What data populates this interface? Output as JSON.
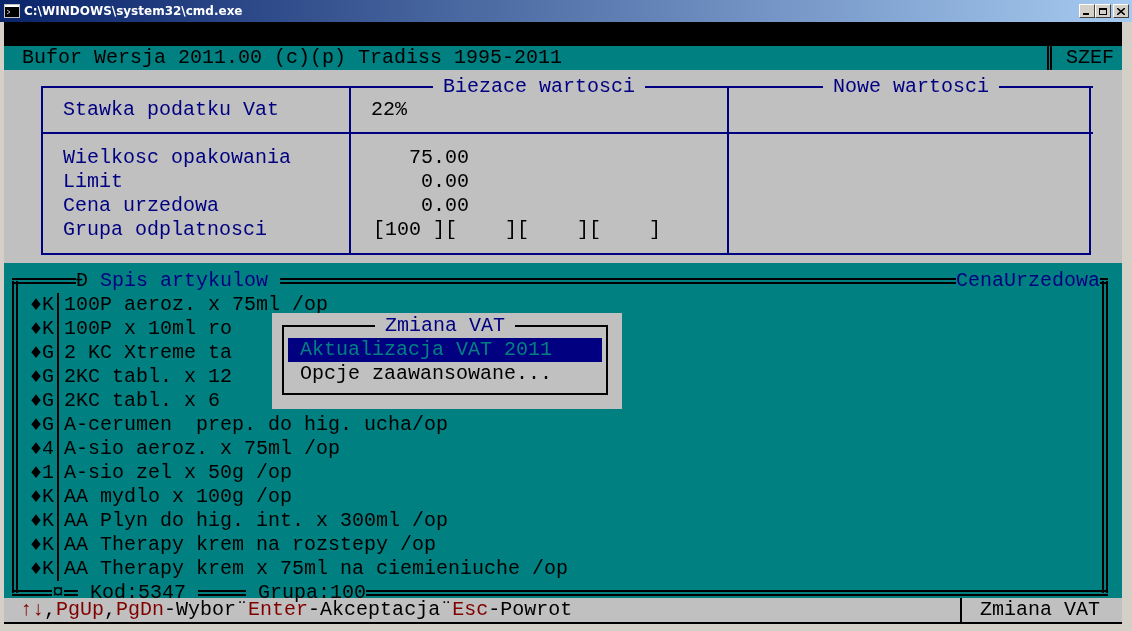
{
  "window": {
    "title": "C:\\WINDOWS\\system32\\cmd.exe"
  },
  "header": {
    "title": "Bufor Wersja 2011.00 (c)(p) Tradiss 1995-2011",
    "user": "SZEF"
  },
  "values_panel": {
    "current_heading": "Biezace wartosci",
    "new_heading": "Nowe wartosci",
    "vat_row": {
      "label": "Stawka podatku Vat",
      "current": "22%"
    },
    "fields": [
      {
        "label": "Wielkosc opakowania",
        "kind": "number",
        "current": "75.00"
      },
      {
        "label": "Limit",
        "kind": "number",
        "current": "0.00"
      },
      {
        "label": "Cena urzedowa",
        "kind": "number",
        "current": "0.00"
      },
      {
        "label": "Grupa odplatnosci",
        "kind": "groups",
        "current": "[100 ][    ][    ][    ]"
      }
    ]
  },
  "article_list": {
    "marker": "Ð",
    "title": "Spis artykulow",
    "right_title": "CenaUrzedowa",
    "rows": [
      {
        "marker": "♦",
        "code": "K",
        "name": "100P aeroz. x 75ml /op"
      },
      {
        "marker": "♦",
        "code": "K",
        "name": "100P x 10ml ro"
      },
      {
        "marker": "♦",
        "code": "G",
        "name": "2 KC Xtreme ta"
      },
      {
        "marker": "♦",
        "code": "G",
        "name": "2KC tabl. x 12"
      },
      {
        "marker": "♦",
        "code": "G",
        "name": "2KC tabl. x 6"
      },
      {
        "marker": "♦",
        "code": "G",
        "name": "A-cerumen  prep. do hig. ucha/op"
      },
      {
        "marker": "♦",
        "code": "4",
        "name": "A-sio aeroz. x 75ml /op"
      },
      {
        "marker": "♦",
        "code": "1",
        "name": "A-sio zel x 50g /op"
      },
      {
        "marker": "♦",
        "code": "K",
        "name": "AA mydlo x 100g /op"
      },
      {
        "marker": "♦",
        "code": "K",
        "name": "AA Plyn do hig. int. x 300ml /op"
      },
      {
        "marker": "♦",
        "code": "K",
        "name": "AA Therapy krem na rozstepy /op"
      },
      {
        "marker": "♦",
        "code": "K",
        "name": "AA Therapy krem x 75ml na ciemieniuche /op"
      }
    ],
    "footer_marker": "¤",
    "code": "Kod:5347",
    "group": "Grupa:100"
  },
  "menu": {
    "title": "Zmiana VAT",
    "items": [
      {
        "label": "Aktualizacja VAT 2011",
        "selected": true
      },
      {
        "label": "Opcje zaawansowane...",
        "selected": false
      }
    ]
  },
  "status_bar": {
    "hints": [
      {
        "kind": "key",
        "text": "↑↓"
      },
      {
        "kind": "text",
        "text": ","
      },
      {
        "kind": "key",
        "text": "PgUp"
      },
      {
        "kind": "text",
        "text": ","
      },
      {
        "kind": "key",
        "text": "PgDn"
      },
      {
        "kind": "text",
        "text": "-Wybor¨"
      },
      {
        "kind": "key",
        "text": "Enter"
      },
      {
        "kind": "text",
        "text": "-Akceptacja¨"
      },
      {
        "kind": "key",
        "text": "Esc"
      },
      {
        "kind": "text",
        "text": "-Powrot"
      }
    ],
    "mode": "Zmiana VAT"
  }
}
